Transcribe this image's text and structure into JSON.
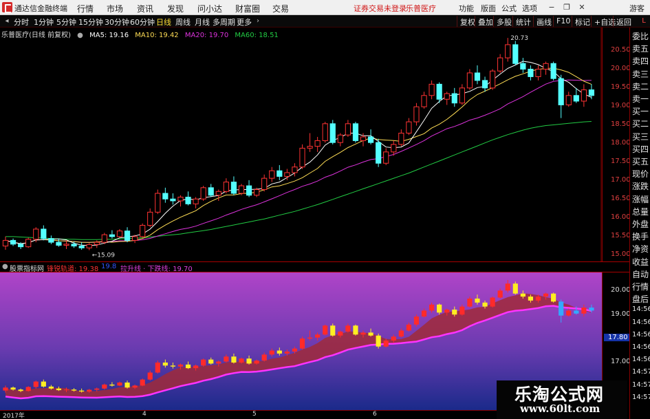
{
  "titlebar": {
    "app_name": "通达信金融终端",
    "menus": [
      "行情",
      "市场",
      "资讯",
      "发现",
      "问小达",
      "财富圈",
      "交易"
    ],
    "notice": "证券交易未登录",
    "stock_name": "乐普医疗",
    "right_menus": [
      "功能",
      "版面",
      "公式",
      "选项"
    ],
    "guest": "游客"
  },
  "toolbar": {
    "periods": [
      "分时",
      "1分钟",
      "5分钟",
      "15分钟",
      "30分钟",
      "60分钟",
      "日线",
      "周线",
      "月线",
      "多周期",
      "更多"
    ],
    "active_period": "日线",
    "right_buttons": [
      "复权",
      "叠加",
      "多股",
      "统计",
      "画线",
      "F10",
      "标记",
      "+自选",
      "返回"
    ]
  },
  "main_info": {
    "title": "乐普医疗(日线 前复权)",
    "ma5": "MA5: 19.16",
    "ma10": "MA10: 19.42",
    "ma20": "MA20: 19.70",
    "ma60": "MA60: 18.51",
    "high_label": "20.73",
    "low_label": "15.09",
    "colors": {
      "ma5": "#ffffff",
      "ma10": "#ffdd55",
      "ma20": "#dd33dd",
      "ma60": "#22cc44"
    }
  },
  "main_axis": [
    "20.50",
    "20.00",
    "19.50",
    "19.00",
    "18.50",
    "18.00",
    "17.50",
    "17.00",
    "16.50",
    "16.00",
    "15.50",
    "15.00"
  ],
  "sub_info": {
    "title": "股票指标网",
    "line1": "锋锐轨道: 19.38",
    "line2": "19.8",
    "line3": "拉升线 · 下跌线: 19.70"
  },
  "sub_axis": [
    "20.00",
    "19.00",
    "17.80",
    "17.00"
  ],
  "time_axis": [
    "2017年",
    "4",
    "5",
    "6"
  ],
  "right_panel": [
    "委比",
    "卖五",
    "卖四",
    "卖三",
    "卖二",
    "卖一",
    "买一",
    "买二",
    "买三",
    "买四",
    "买五",
    "现价",
    "涨跌",
    "涨幅",
    "总量",
    "外盘",
    "换手",
    "净资",
    "收益",
    "自动",
    "行情",
    "盘后",
    "14:56",
    "14:56",
    "14:56",
    "14:56",
    "14:56",
    "14:57",
    "14:57",
    "14:57"
  ],
  "watermark": {
    "line1": "乐淘公式网",
    "line2": "www.60lt.com"
  },
  "chart_data": {
    "type": "candlestick",
    "unit": "CNY",
    "ylim": [
      14.9,
      20.75
    ],
    "candles": [
      [
        15.2,
        15.45,
        15.1,
        15.35
      ],
      [
        15.35,
        15.4,
        15.2,
        15.25
      ],
      [
        15.25,
        15.3,
        15.12,
        15.18
      ],
      [
        15.18,
        15.42,
        15.15,
        15.38
      ],
      [
        15.38,
        15.7,
        15.3,
        15.65
      ],
      [
        15.65,
        15.75,
        15.35,
        15.4
      ],
      [
        15.4,
        15.48,
        15.25,
        15.3
      ],
      [
        15.3,
        15.4,
        15.18,
        15.22
      ],
      [
        15.22,
        15.35,
        15.12,
        15.25
      ],
      [
        15.25,
        15.32,
        15.15,
        15.2
      ],
      [
        15.2,
        15.3,
        15.1,
        15.15
      ],
      [
        15.15,
        15.28,
        15.09,
        15.24
      ],
      [
        15.24,
        15.35,
        15.15,
        15.3
      ],
      [
        15.3,
        15.55,
        15.25,
        15.5
      ],
      [
        15.5,
        15.62,
        15.4,
        15.45
      ],
      [
        15.45,
        15.65,
        15.42,
        15.6
      ],
      [
        15.6,
        15.7,
        15.3,
        15.35
      ],
      [
        15.35,
        15.5,
        15.28,
        15.45
      ],
      [
        15.45,
        15.8,
        15.42,
        15.75
      ],
      [
        15.75,
        16.2,
        15.7,
        16.1
      ],
      [
        16.1,
        16.7,
        16.05,
        16.6
      ],
      [
        16.6,
        16.75,
        16.35,
        16.45
      ],
      [
        16.45,
        16.6,
        16.3,
        16.4
      ],
      [
        16.4,
        16.55,
        16.25,
        16.5
      ],
      [
        16.5,
        16.65,
        16.28,
        16.32
      ],
      [
        16.32,
        16.5,
        16.2,
        16.45
      ],
      [
        16.45,
        16.8,
        16.4,
        16.75
      ],
      [
        16.75,
        16.85,
        16.5,
        16.55
      ],
      [
        16.55,
        16.7,
        16.4,
        16.65
      ],
      [
        16.65,
        17.0,
        16.6,
        16.9
      ],
      [
        16.9,
        17.05,
        16.55,
        16.6
      ],
      [
        16.6,
        16.85,
        16.55,
        16.8
      ],
      [
        16.8,
        16.95,
        16.5,
        16.55
      ],
      [
        16.55,
        16.75,
        16.5,
        16.7
      ],
      [
        16.7,
        17.1,
        16.65,
        17.0
      ],
      [
        17.0,
        17.3,
        16.9,
        17.2
      ],
      [
        17.2,
        17.35,
        16.95,
        17.05
      ],
      [
        17.05,
        17.25,
        16.95,
        17.15
      ],
      [
        17.15,
        17.4,
        17.05,
        17.3
      ],
      [
        17.3,
        17.9,
        17.25,
        17.8
      ],
      [
        17.8,
        18.2,
        17.7,
        17.85
      ],
      [
        17.85,
        18.1,
        17.7,
        18.0
      ],
      [
        18.0,
        18.5,
        17.95,
        18.45
      ],
      [
        18.45,
        18.55,
        17.9,
        17.95
      ],
      [
        17.95,
        18.2,
        17.85,
        18.15
      ],
      [
        18.15,
        18.55,
        18.1,
        18.45
      ],
      [
        18.45,
        18.5,
        17.95,
        18.0
      ],
      [
        18.0,
        18.2,
        17.85,
        18.1
      ],
      [
        18.1,
        18.3,
        17.9,
        17.95
      ],
      [
        17.95,
        18.05,
        17.3,
        17.4
      ],
      [
        17.4,
        17.8,
        17.35,
        17.7
      ],
      [
        17.7,
        18.0,
        17.6,
        17.9
      ],
      [
        17.9,
        18.3,
        17.85,
        18.2
      ],
      [
        18.2,
        18.6,
        18.15,
        18.5
      ],
      [
        18.5,
        19.0,
        18.4,
        18.9
      ],
      [
        18.9,
        19.3,
        18.85,
        19.2
      ],
      [
        19.2,
        19.6,
        19.1,
        19.5
      ],
      [
        19.5,
        19.55,
        19.0,
        19.1
      ],
      [
        19.1,
        19.3,
        18.95,
        19.25
      ],
      [
        19.25,
        19.4,
        18.9,
        19.0
      ],
      [
        19.0,
        19.5,
        18.95,
        19.4
      ],
      [
        19.4,
        19.9,
        19.35,
        19.8
      ],
      [
        19.8,
        20.0,
        19.5,
        19.6
      ],
      [
        19.6,
        19.7,
        19.3,
        19.4
      ],
      [
        19.4,
        19.9,
        19.35,
        19.85
      ],
      [
        19.85,
        20.3,
        19.8,
        20.2
      ],
      [
        20.2,
        20.73,
        20.1,
        20.55
      ],
      [
        20.55,
        20.65,
        20.0,
        20.05
      ],
      [
        20.05,
        20.2,
        19.8,
        19.9
      ],
      [
        19.9,
        20.0,
        19.6,
        19.7
      ],
      [
        19.7,
        20.0,
        19.6,
        19.9
      ],
      [
        19.9,
        20.1,
        19.75,
        20.05
      ],
      [
        20.05,
        20.1,
        19.6,
        19.65
      ],
      [
        19.65,
        19.75,
        18.6,
        18.95
      ],
      [
        18.95,
        19.3,
        18.9,
        19.2
      ],
      [
        19.2,
        19.4,
        19.0,
        19.05
      ],
      [
        19.05,
        19.5,
        18.9,
        19.35
      ],
      [
        19.35,
        19.5,
        19.1,
        19.2
      ]
    ],
    "ma60": [
      15.45,
      15.45,
      15.44,
      15.43,
      15.42,
      15.41,
      15.4,
      15.39,
      15.38,
      15.38,
      15.37,
      15.37,
      15.37,
      15.38,
      15.38,
      15.39,
      15.4,
      15.41,
      15.42,
      15.44,
      15.46,
      15.48,
      15.5,
      15.52,
      15.55,
      15.58,
      15.61,
      15.64,
      15.68,
      15.72,
      15.76,
      15.8,
      15.84,
      15.88,
      15.92,
      15.97,
      16.02,
      16.07,
      16.12,
      16.18,
      16.24,
      16.3,
      16.37,
      16.44,
      16.51,
      16.58,
      16.65,
      16.72,
      16.79,
      16.86,
      16.93,
      17.0,
      17.07,
      17.14,
      17.22,
      17.3,
      17.38,
      17.46,
      17.54,
      17.62,
      17.7,
      17.78,
      17.86,
      17.94,
      18.02,
      18.09,
      18.16,
      18.22,
      18.28,
      18.33,
      18.37,
      18.4,
      18.42,
      18.44,
      18.46,
      18.48,
      18.5,
      18.51
    ]
  }
}
